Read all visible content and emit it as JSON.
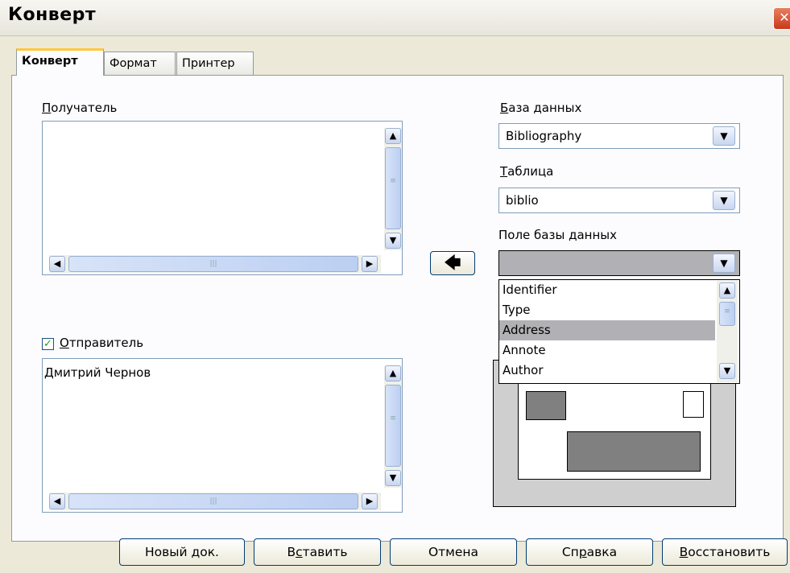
{
  "window": {
    "title": "Конверт",
    "close_glyph": "✕"
  },
  "tabs": [
    {
      "label": "Конверт",
      "active": true
    },
    {
      "label": "Формат",
      "active": false
    },
    {
      "label": "Принтер",
      "active": false
    }
  ],
  "recipient": {
    "label_prefix": "П",
    "label_rest": "олучатель",
    "text": ""
  },
  "arrow_button": {
    "glyph": "🡄"
  },
  "sender": {
    "checked": true,
    "label_prefix": "О",
    "label_rest": "тправитель",
    "text": "Дмитрий Чернов"
  },
  "database": {
    "label_prefix": "Б",
    "label_rest": "аза данных",
    "value": "Bibliography"
  },
  "table": {
    "label_prefix": "Т",
    "label_rest": "аблица",
    "value": "biblio"
  },
  "db_field": {
    "label_prefix": "Поле базы ",
    "label_under": "д",
    "label_rest": "анных",
    "value": "",
    "options": [
      "Identifier",
      "Type",
      "Address",
      "Annote",
      "Author"
    ],
    "selected": "Address"
  },
  "buttons": {
    "new_doc": "Новый док.",
    "insert_pre": "В",
    "insert_u": "с",
    "insert_post": "тавить",
    "cancel": "Отмена",
    "help_pre": "Сп",
    "help_u": "р",
    "help_post": "авка",
    "reset_u": "В",
    "reset_post": "осстановить"
  },
  "icons": {
    "scroll_up": "▲",
    "scroll_down": "▼",
    "scroll_left": "◀",
    "scroll_right": "▶",
    "dropdown": "▼",
    "grip": "≡",
    "grip_h": "|||",
    "check": "✓"
  }
}
